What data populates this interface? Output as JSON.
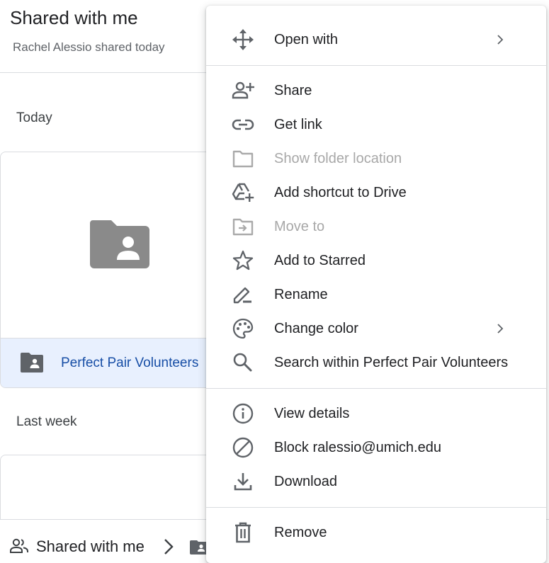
{
  "page": {
    "title": "Shared with me",
    "subtitle": "Rachel Alessio shared today"
  },
  "sections": {
    "today": "Today",
    "last_week": "Last week"
  },
  "card": {
    "name": "Perfect Pair Volunteers",
    "icon": "shared-folder-icon"
  },
  "breadcrumb": {
    "root_label": "Shared with me",
    "root_icon": "people-icon",
    "separator_icon": "chevron-right-icon",
    "current_icon": "shared-folder-icon"
  },
  "colors": {
    "accent_text": "#174ea6",
    "selected_bg": "#e8f0fe",
    "icon_gray": "#5f6368",
    "disabled_text": "#a8a8a8"
  },
  "context_menu": {
    "items": [
      {
        "label": "Open with",
        "icon": "move-arrows-icon",
        "submenu": true
      },
      {
        "label": "Share",
        "icon": "person-add-icon"
      },
      {
        "label": "Get link",
        "icon": "link-icon"
      },
      {
        "label": "Show folder location",
        "icon": "folder-outline-icon",
        "disabled": true
      },
      {
        "label": "Add shortcut to Drive",
        "icon": "drive-shortcut-icon"
      },
      {
        "label": "Move to",
        "icon": "folder-move-icon",
        "disabled": true
      },
      {
        "label": "Add to Starred",
        "icon": "star-icon"
      },
      {
        "label": "Rename",
        "icon": "pencil-icon"
      },
      {
        "label": "Change color",
        "icon": "palette-icon",
        "submenu": true
      },
      {
        "label": "Search within Perfect Pair Volunteers",
        "icon": "search-icon"
      },
      {
        "label": "View details",
        "icon": "info-icon"
      },
      {
        "label": "Block ralessio@umich.edu",
        "icon": "block-icon"
      },
      {
        "label": "Download",
        "icon": "download-icon"
      },
      {
        "label": "Remove",
        "icon": "trash-icon"
      }
    ]
  }
}
